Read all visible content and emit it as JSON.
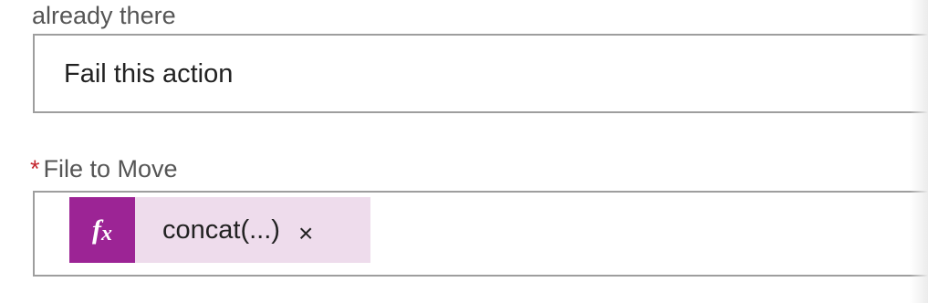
{
  "previous_field": {
    "label_tail": "already there",
    "value": "Fail this action"
  },
  "file_to_move": {
    "required_marker": "*",
    "label": "File to Move",
    "token": {
      "icon_text": "fx",
      "icon": "function-icon",
      "label": "concat(...)",
      "remove": "×",
      "remove_icon": "close-icon"
    }
  },
  "colors": {
    "token_icon_bg": "#9c2495",
    "token_bg": "#eedcec",
    "required": "#c4262e",
    "border": "#9e9e9e"
  }
}
